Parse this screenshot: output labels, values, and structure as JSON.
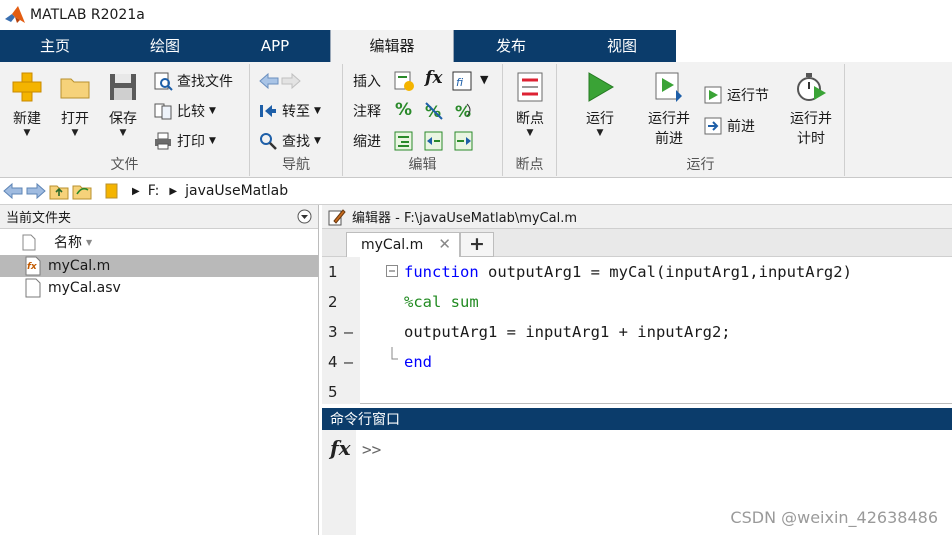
{
  "window": {
    "title": "MATLAB R2021a"
  },
  "tabs": [
    {
      "label": "主页"
    },
    {
      "label": "绘图"
    },
    {
      "label": "APP"
    },
    {
      "label": "编辑器"
    },
    {
      "label": "发布"
    },
    {
      "label": "视图"
    }
  ],
  "ribbon": {
    "file": {
      "label": "文件",
      "new": "新建",
      "open": "打开",
      "save": "保存",
      "find_files": "查找文件",
      "compare": "比较",
      "print": "打印"
    },
    "navigate": {
      "label": "导航",
      "goto": "转至",
      "find": "查找"
    },
    "edit": {
      "label": "编辑",
      "insert": "插入",
      "comment": "注释",
      "indent": "缩进",
      "fx": "fx",
      "percent": "%"
    },
    "breakpoints": {
      "label": "断点",
      "button": "断点"
    },
    "run": {
      "label": "运行",
      "run": "运行",
      "run_advance_1": "运行并",
      "run_advance_2": "前进",
      "run_section": "运行节",
      "advance": "前进",
      "run_time_1": "运行并",
      "run_time_2": "计时"
    }
  },
  "address": {
    "drive": "F:",
    "folder": "javaUseMatlab"
  },
  "file_browser": {
    "title": "当前文件夹",
    "column_name": "名称",
    "files": [
      {
        "name": "myCal.m",
        "selected": true
      },
      {
        "name": "myCal.asv",
        "selected": false
      }
    ]
  },
  "editor": {
    "title": "编辑器 - F:\\javaUseMatlab\\myCal.m",
    "tab": "myCal.m",
    "lines": [
      {
        "num": "1",
        "bp": "",
        "keyword": "function",
        "text": " outputArg1 = myCal(inputArg1,inputArg2)"
      },
      {
        "num": "2",
        "bp": "",
        "comment": "%cal sum"
      },
      {
        "num": "3",
        "bp": "—",
        "text": "outputArg1 = inputArg1 + inputArg2;"
      },
      {
        "num": "4",
        "bp": "—",
        "keyword": "end"
      },
      {
        "num": "5",
        "bp": ""
      }
    ]
  },
  "command_window": {
    "title": "命令行窗口",
    "fx": "fx",
    "prompt": ">>"
  },
  "watermark": "CSDN @weixin_42638486"
}
